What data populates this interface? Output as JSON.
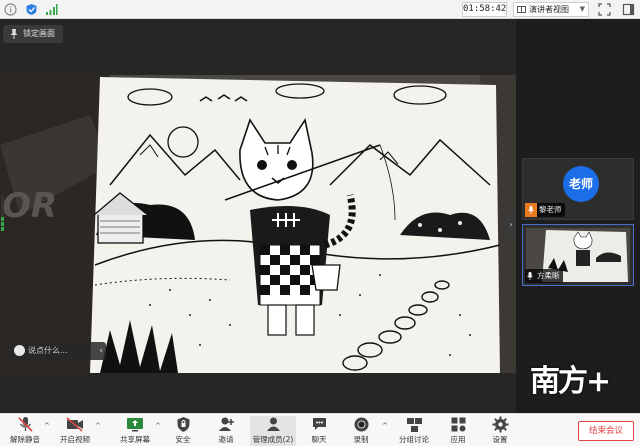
{
  "topbar": {
    "timer": "01:58:42",
    "view_label": "演讲者视图"
  },
  "main": {
    "lock_label": "锁定画面",
    "chat_placeholder": "说点什么..."
  },
  "participants": [
    {
      "name": "黎老师",
      "avatar_text": "老师"
    },
    {
      "name": "方柔晰"
    }
  ],
  "watermark": "南方+",
  "toolbar": {
    "items": [
      {
        "label": "解除静音"
      },
      {
        "label": "开启视频"
      },
      {
        "label": "共享屏幕"
      },
      {
        "label": "安全"
      },
      {
        "label": "邀请"
      },
      {
        "label": "管理成员(2)"
      },
      {
        "label": "聊天"
      },
      {
        "label": "录制"
      },
      {
        "label": "分组讨论"
      },
      {
        "label": "应用"
      },
      {
        "label": "设置"
      }
    ],
    "end_label": "结束会议"
  },
  "colors": {
    "accent_blue": "#1c6ee8",
    "end_red": "#e04646",
    "host_orange": "#e87b1e"
  }
}
